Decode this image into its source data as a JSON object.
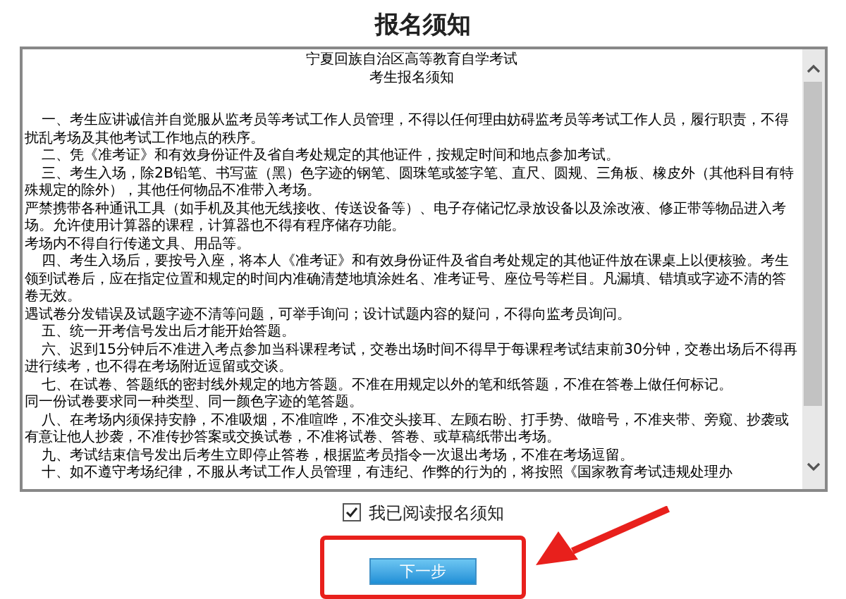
{
  "title": "报名须知",
  "notice": {
    "heading_lines": [
      "宁夏回族自治区高等教育自学考试",
      "考生报名须知"
    ],
    "paragraphs": [
      {
        "text": "一、考生应讲诚信并自觉服从监考员等考试工作人员管理，不得以任何理由妨碍监考员等考试工作人员，履行职责，不得扰乱考场及其他考试工作地点的秩序。",
        "indent": true
      },
      {
        "text": "二、凭《准考证》和有效身份证件及省自考处规定的其他证件，按规定时间和地点参加考试。",
        "indent": true
      },
      {
        "text": "三、考生入场，除2B铅笔、书写蓝（黑）色字迹的钢笔、圆珠笔或签字笔、直尺、圆规、三角板、橡皮外（其他科目有特殊规定的除外），其他任何物品不准带入考场。",
        "indent": true
      },
      {
        "text": "严禁携带各种通讯工具（如手机及其他无线接收、传送设备等）、电子存储记忆录放设备以及涂改液、修正带等物品进入考场。允许使用计算器的课程，计算器也不得有程序储存功能。",
        "indent": false
      },
      {
        "text": "考场内不得自行传递文具、用品等。",
        "indent": false
      },
      {
        "text": "四、考生入场后，要按号入座，将本人《准考证》和有效身份证件及省自考处规定的其他证件放在课桌上以便核验。考生领到试卷后，应在指定位置和规定的时间内准确清楚地填涂姓名、准考证号、座位号等栏目。凡漏填、错填或字迹不清的答卷无效。",
        "indent": true
      },
      {
        "text": "遇试卷分发错误及试题字迹不清等问题，可举手询问；设计试题内容的疑问，不得向监考员询问。",
        "indent": false
      },
      {
        "text": "五、统一开考信号发出后才能开始答题。",
        "indent": true
      },
      {
        "text": "六、迟到15分钟后不准进入考点参加当科课程考试，交卷出场时间不得早于每课程考试结束前30分钟，交卷出场后不得再进行续考，也不得在考场附近逗留或交谈。",
        "indent": true
      },
      {
        "text": "七、在试卷、答题纸的密封线外规定的地方答题。不准在用规定以外的笔和纸答题，不准在答卷上做任何标记。",
        "indent": true
      },
      {
        "text": "同一份试卷要求同一种类型、同一颜色字迹的笔答题。",
        "indent": false
      },
      {
        "text": "八、在考场内须保持安静，不准吸烟，不准喧哗，不准交头接耳、左顾右盼、打手势、做暗号，不准夹带、旁窥、抄袭或有意让他人抄袭，不准传抄答案或交换试卷，不准将试卷、答卷、或草稿纸带出考场。",
        "indent": true
      },
      {
        "text": "九、考试结束信号发出后考生立即停止答卷，根据监考员指令一次退出考场，不准在考场逗留。",
        "indent": true
      },
      {
        "text": "十、如不遵守考场纪律，不服从考试工作人员管理，有违纪、作弊的行为的，将按照《国家教育考试违规处理办",
        "indent": true
      }
    ]
  },
  "agreement": {
    "label": "我已阅读报名须知",
    "checked": true
  },
  "next_button": {
    "label": "下一步"
  }
}
